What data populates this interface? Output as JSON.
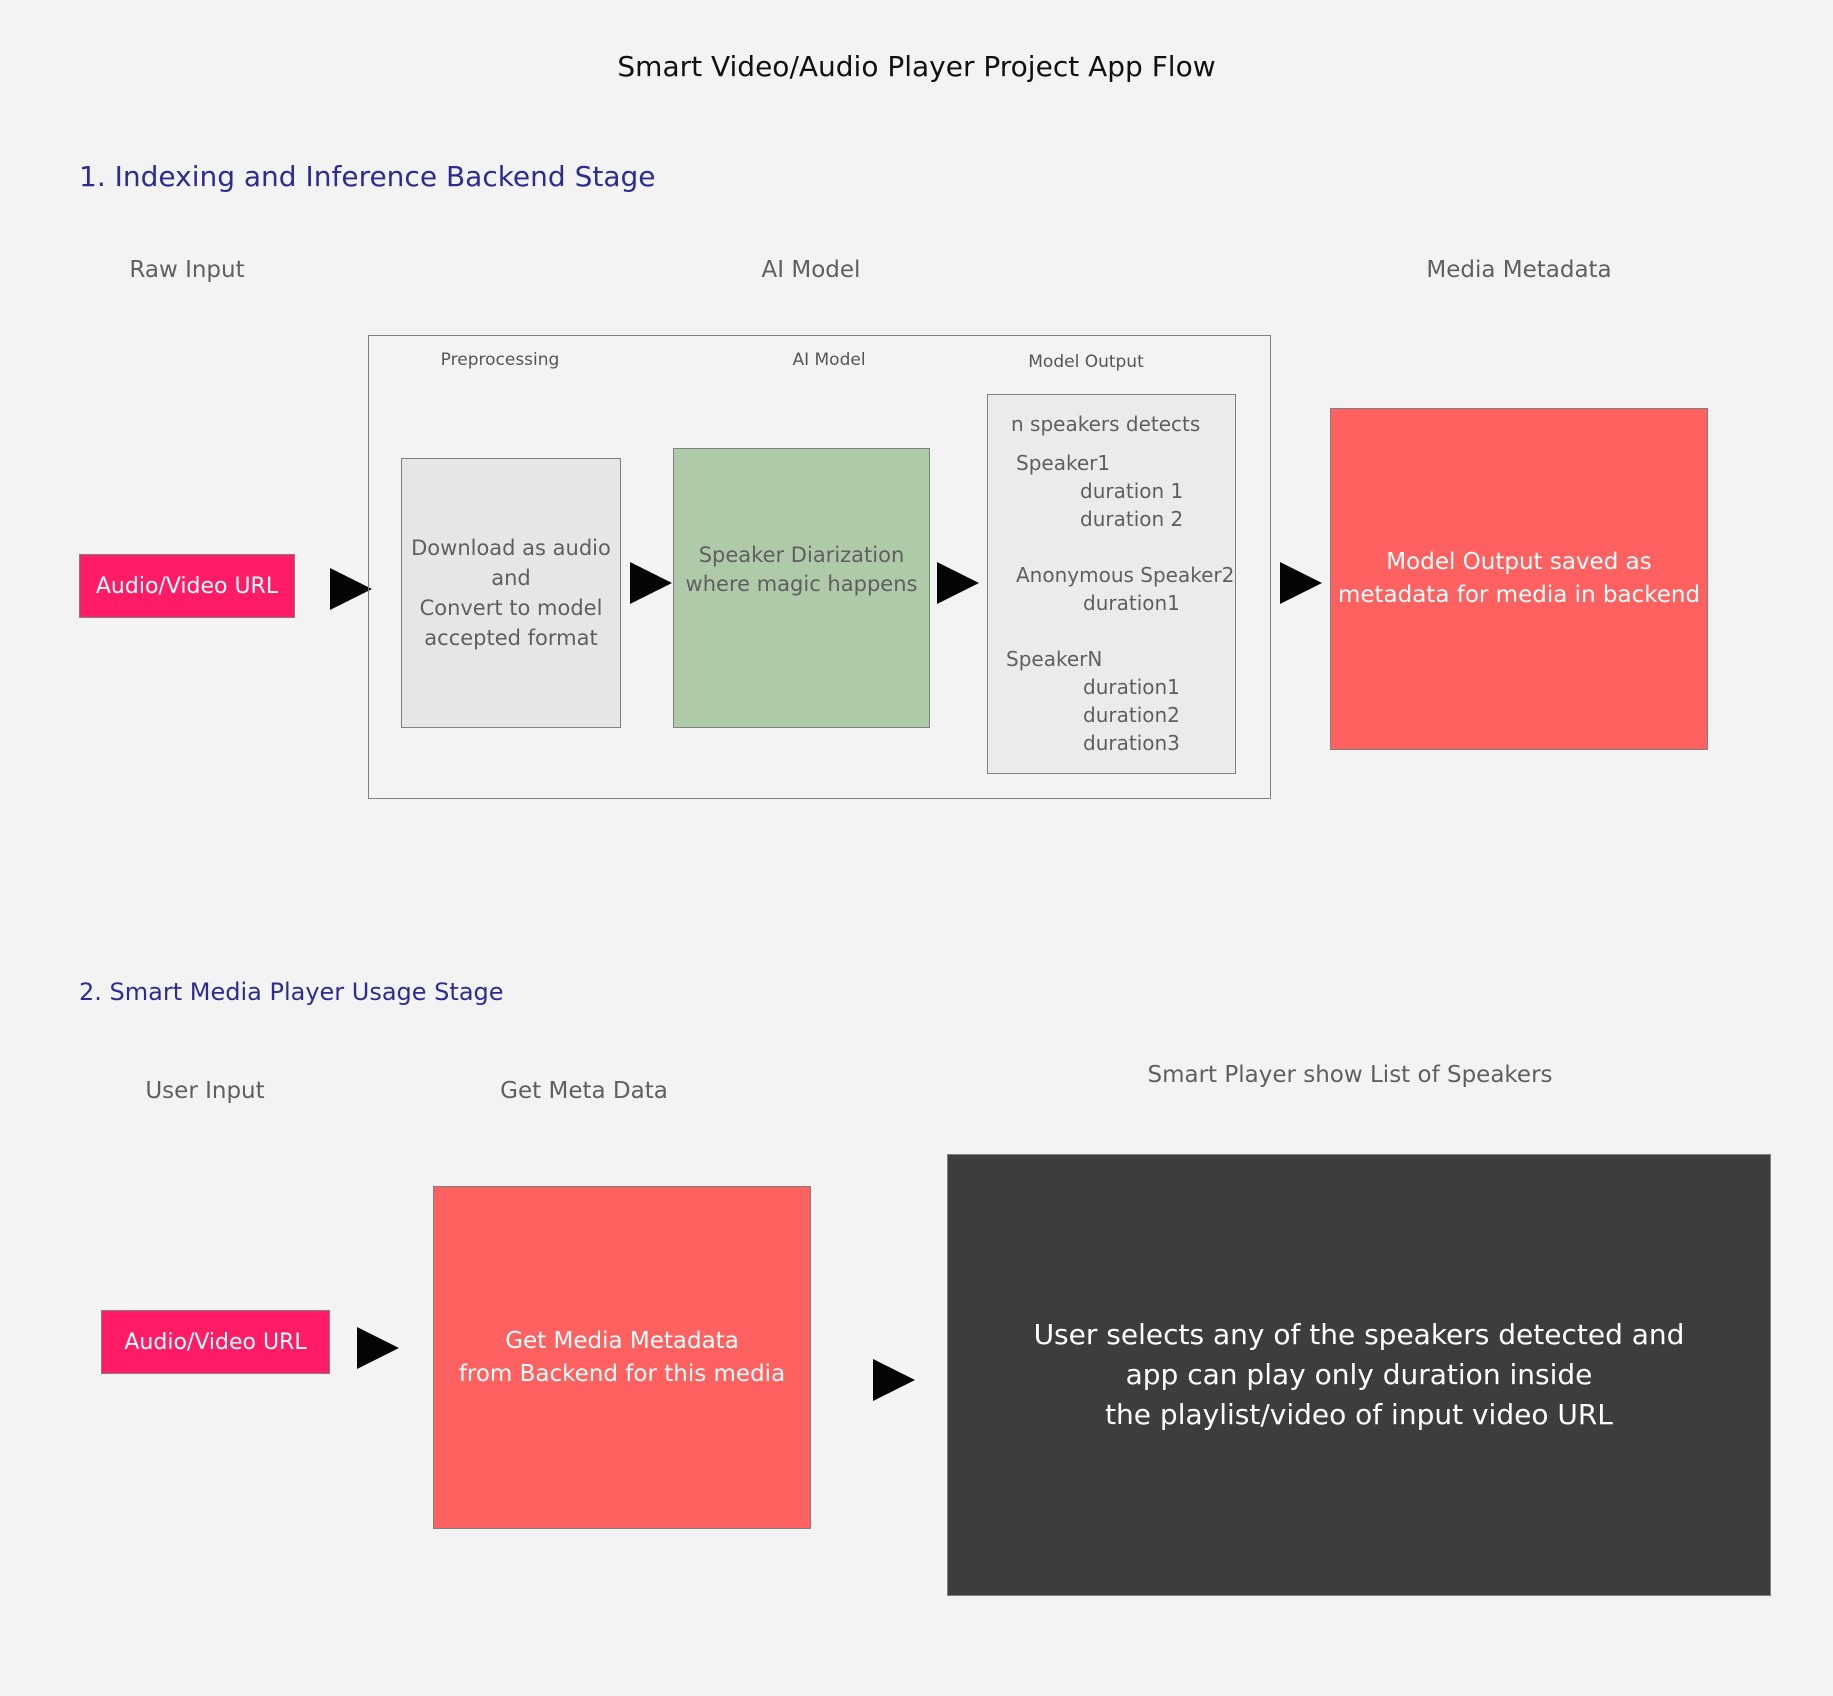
{
  "title": "Smart Video/Audio Player Project App Flow",
  "stage1": {
    "heading": "1. Indexing and Inference Backend Stage",
    "column_labels": {
      "raw_input": "Raw Input",
      "ai_model": "AI Model",
      "media_metadata": "Media Metadata"
    },
    "input_box": "Audio/Video URL",
    "pipeline": {
      "preprocessing_label": "Preprocessing",
      "preprocessing_text": "Download as audio\nand\nConvert to model\n accepted format",
      "ai_model_label": "AI Model",
      "ai_model_text": "Speaker Diarization\nwhere magic happens",
      "model_output_label": "Model Output",
      "model_output": {
        "header": "n speakers detects",
        "speakers": [
          {
            "name": "Speaker1",
            "durations": [
              "duration 1",
              "duration 2"
            ]
          },
          {
            "name": "Anonymous Speaker2",
            "durations": [
              "duration1"
            ]
          },
          {
            "name": "SpeakerN",
            "durations": [
              "duration1",
              "duration2",
              "duration3"
            ]
          }
        ]
      }
    },
    "metadata_box": "Model Output saved as\n metadata for media in backend"
  },
  "stage2": {
    "heading": "2. Smart Media Player Usage Stage",
    "column_labels": {
      "user_input": "User Input",
      "get_meta": "Get Meta Data",
      "player": "Smart Player show List of Speakers"
    },
    "input_box": "Audio/Video URL",
    "metadata_box": "Get Media Metadata\nfrom Backend for this media",
    "player_box": "User selects any of the speakers detected and\napp can play only duration inside\nthe playlist/video of input video URL"
  },
  "colors": {
    "background": "#f3f3f3",
    "heading": "#2e2b91",
    "input_box": "#ff1b66",
    "red_box": "#ff6161",
    "green_box": "#aecaa9",
    "gray_box": "#e6e6e6",
    "dark_box": "#3d3d3d"
  }
}
